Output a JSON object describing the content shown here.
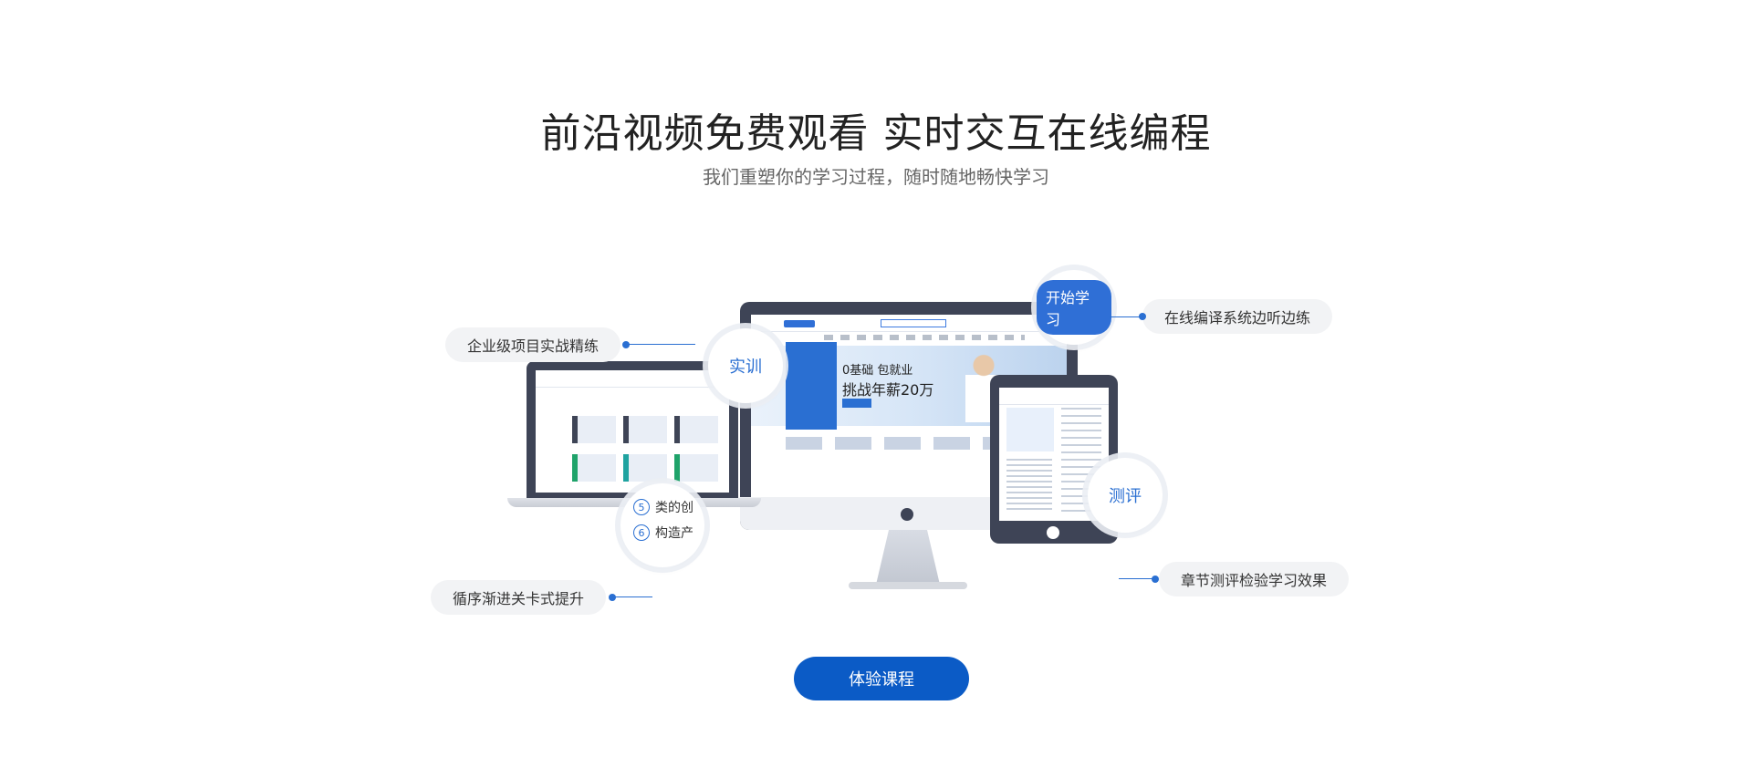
{
  "hero": {
    "title": "前沿视频免费观看 实时交互在线编程",
    "subtitle": "我们重塑你的学习过程，随时随地畅快学习"
  },
  "callouts": {
    "practice": "企业级项目实战精练",
    "compile": "在线编译系统边听边练",
    "progress": "循序渐进关卡式提升",
    "test": "章节测评检验学习效果"
  },
  "bubbles": {
    "training": "实训",
    "start": "开始学习",
    "evaluation": "测评",
    "list_items": [
      {
        "num": "5",
        "label": "类的创"
      },
      {
        "num": "6",
        "label": "构造产"
      }
    ]
  },
  "device_screen": {
    "banner_line1": "0基础 包就业",
    "banner_line2": "挑战年薪20万"
  },
  "cta": {
    "label": "体验课程"
  },
  "colors": {
    "accent": "#2a6fd2",
    "cta": "#0b5bc6",
    "device": "#3e4456"
  }
}
